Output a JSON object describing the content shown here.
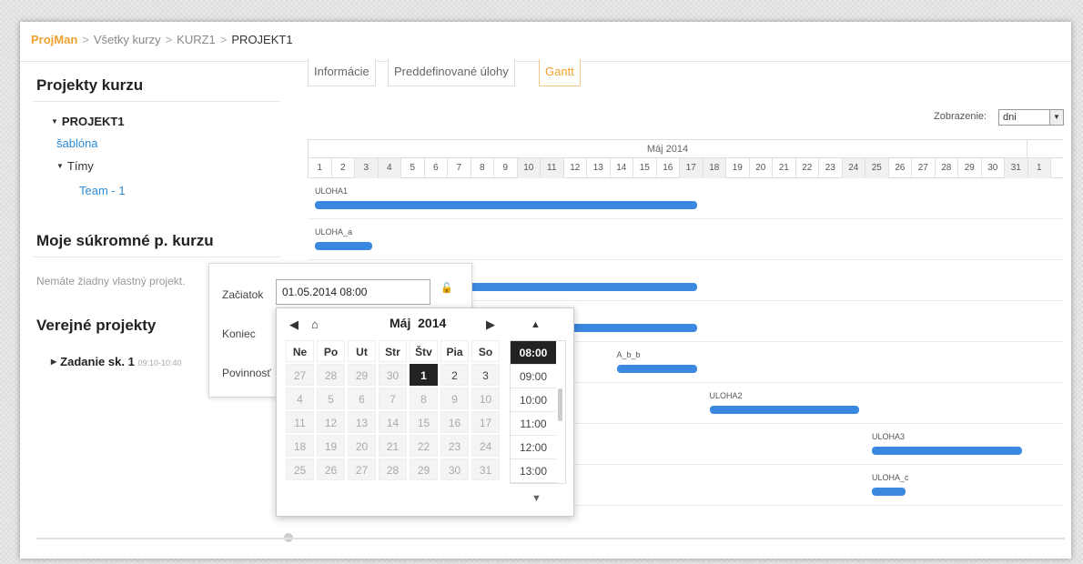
{
  "breadcrumb": {
    "brand": "ProjMan",
    "sep": ">",
    "items": [
      "Všetky kurzy",
      "KURZ1",
      "PROJEKT1"
    ]
  },
  "sidebar": {
    "projects_heading": "Projekty kurzu",
    "project_name": "PROJEKT1",
    "template_link": "šablóna",
    "teams_label": "Tímy",
    "team_item": "Team - 1",
    "private_heading": "Moje súkromné p. kurzu",
    "private_empty": "Nemáte žiadny vlastný projekt.",
    "public_heading": "Verejné projekty",
    "public_item": "Zadanie sk. 1",
    "public_item_time": "09:10-10:40"
  },
  "tabs": [
    "Informácie",
    "Preddefinované úlohy",
    "Gantt"
  ],
  "view": {
    "label": "Zobrazenie:",
    "value": "dni"
  },
  "gantt": {
    "month": "Máj 2014",
    "days": [
      "1",
      "2",
      "3",
      "4",
      "5",
      "6",
      "7",
      "8",
      "9",
      "10",
      "11",
      "12",
      "13",
      "14",
      "15",
      "16",
      "17",
      "18",
      "19",
      "20",
      "21",
      "22",
      "23",
      "24",
      "25",
      "26",
      "27",
      "28",
      "29",
      "30",
      "31",
      "1"
    ],
    "tasks": [
      {
        "name": "ULOHA1",
        "start": 1,
        "end": 17
      },
      {
        "name": "ULOHA_a",
        "start": 1,
        "end": 3
      },
      {
        "name": "",
        "start": 5,
        "end": 17
      },
      {
        "name": "",
        "start": 5,
        "end": 17
      },
      {
        "name": "A_b_b",
        "start": 14,
        "end": 17
      },
      {
        "name": "ULOHA2",
        "start": 18,
        "end": 24
      },
      {
        "name": "ULOHA3",
        "start": 25,
        "end": 31
      },
      {
        "name": "ULOHA_c",
        "start": 25,
        "end": 26
      }
    ]
  },
  "editor": {
    "start_label": "Začiatok",
    "start_value": "01.05.2014 08:00",
    "end_label": "Koniec",
    "duty_label": "Povinnosť"
  },
  "picker": {
    "month": "Máj",
    "year": "2014",
    "weekdays": [
      "Ne",
      "Po",
      "Ut",
      "Str",
      "Štv",
      "Pia",
      "So"
    ],
    "weeks": [
      [
        "27",
        "28",
        "29",
        "30",
        "1",
        "2",
        "3"
      ],
      [
        "4",
        "5",
        "6",
        "7",
        "8",
        "9",
        "10"
      ],
      [
        "11",
        "12",
        "13",
        "14",
        "15",
        "16",
        "17"
      ],
      [
        "18",
        "19",
        "20",
        "21",
        "22",
        "23",
        "24"
      ],
      [
        "25",
        "26",
        "27",
        "28",
        "29",
        "30",
        "31"
      ]
    ],
    "current_month_mask": [
      [
        0,
        0,
        0,
        0,
        1,
        1,
        1
      ],
      [
        0,
        0,
        0,
        0,
        0,
        0,
        0
      ],
      [
        0,
        0,
        0,
        0,
        0,
        0,
        0
      ],
      [
        0,
        0,
        0,
        0,
        0,
        0,
        0
      ],
      [
        0,
        0,
        0,
        0,
        0,
        0,
        0
      ]
    ],
    "selected_day": "1",
    "times": [
      "08:00",
      "09:00",
      "10:00",
      "11:00",
      "12:00",
      "13:00"
    ],
    "selected_time": "08:00"
  }
}
